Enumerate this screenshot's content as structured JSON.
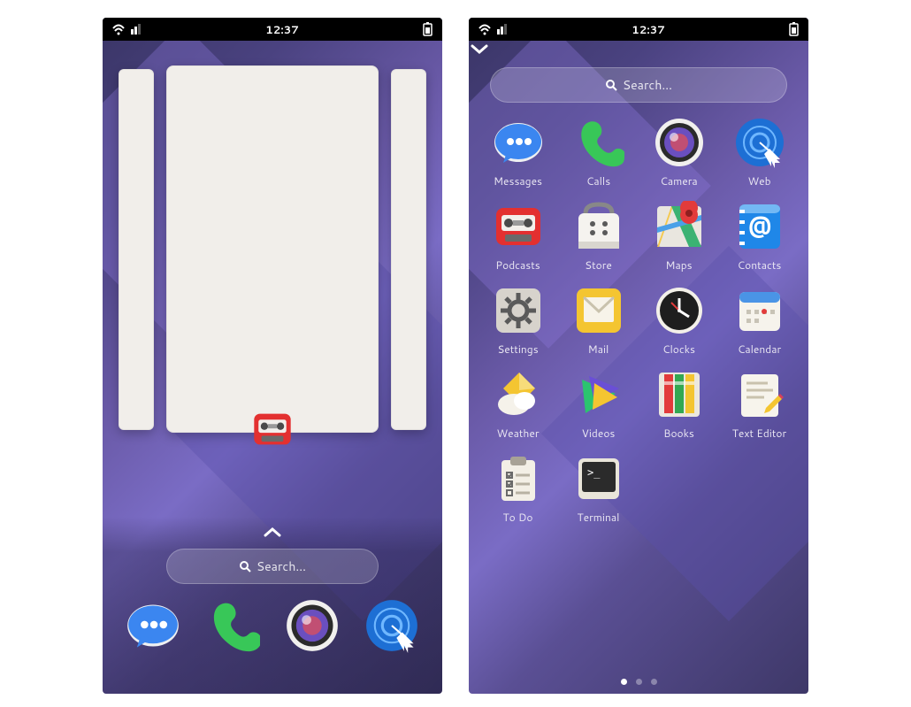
{
  "statusbar": {
    "time": "12:37"
  },
  "search": {
    "placeholder": "Search…"
  },
  "overview": {
    "center_app_icon": "podcasts-icon"
  },
  "dock": [
    {
      "name": "Messages",
      "icon": "messages-icon"
    },
    {
      "name": "Calls",
      "icon": "calls-icon"
    },
    {
      "name": "Camera",
      "icon": "camera-icon"
    },
    {
      "name": "Web",
      "icon": "web-icon"
    }
  ],
  "apps": [
    {
      "name": "Messages",
      "icon": "messages-icon"
    },
    {
      "name": "Calls",
      "icon": "calls-icon"
    },
    {
      "name": "Camera",
      "icon": "camera-icon"
    },
    {
      "name": "Web",
      "icon": "web-icon"
    },
    {
      "name": "Podcasts",
      "icon": "podcasts-icon"
    },
    {
      "name": "Store",
      "icon": "store-icon"
    },
    {
      "name": "Maps",
      "icon": "maps-icon"
    },
    {
      "name": "Contacts",
      "icon": "contacts-icon"
    },
    {
      "name": "Settings",
      "icon": "settings-icon"
    },
    {
      "name": "Mail",
      "icon": "mail-icon"
    },
    {
      "name": "Clocks",
      "icon": "clocks-icon"
    },
    {
      "name": "Calendar",
      "icon": "calendar-icon"
    },
    {
      "name": "Weather",
      "icon": "weather-icon"
    },
    {
      "name": "Videos",
      "icon": "videos-icon"
    },
    {
      "name": "Books",
      "icon": "books-icon"
    },
    {
      "name": "Text Editor",
      "icon": "text-editor-icon"
    },
    {
      "name": "To Do",
      "icon": "todo-icon"
    },
    {
      "name": "Terminal",
      "icon": "terminal-icon"
    }
  ],
  "pager": {
    "count": 3,
    "active": 0
  }
}
